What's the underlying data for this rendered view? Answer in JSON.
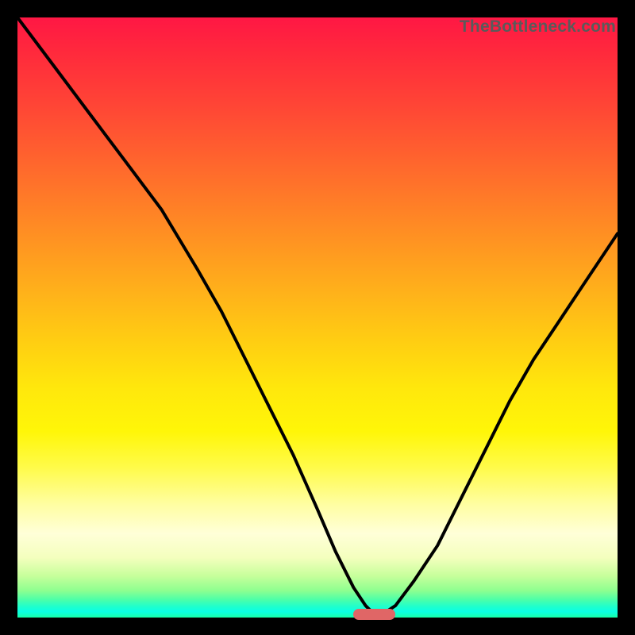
{
  "watermark": "TheBottleneck.com",
  "colors": {
    "frame": "#000000",
    "curve": "#000000",
    "marker": "#e06666",
    "gradient_top": "#ff1744",
    "gradient_mid": "#ffe80c",
    "gradient_bottom": "#18ffa8"
  },
  "chart_data": {
    "type": "line",
    "title": "",
    "xlabel": "",
    "ylabel": "",
    "xlim": [
      0,
      100
    ],
    "ylim": [
      0,
      100
    ],
    "grid": false,
    "legend": false,
    "note": "Axes unlabeled in source; x is 0–100 left→right, y is 0 at bottom, 100 at top. Curve values estimated from pixels.",
    "series": [
      {
        "name": "bottleneck-curve",
        "x": [
          0,
          6,
          12,
          18,
          24,
          30,
          34,
          38,
          42,
          46,
          50,
          53,
          56,
          58,
          60,
          63,
          66,
          70,
          74,
          78,
          82,
          86,
          90,
          94,
          100
        ],
        "values": [
          100,
          92,
          84,
          76,
          68,
          58,
          51,
          43,
          35,
          27,
          18,
          11,
          5,
          2,
          0,
          2,
          6,
          12,
          20,
          28,
          36,
          43,
          49,
          55,
          64
        ]
      }
    ],
    "annotations": [
      {
        "name": "optimal-marker",
        "shape": "pill",
        "x_range": [
          56,
          63
        ],
        "y": 0.5,
        "color": "#e06666"
      }
    ]
  }
}
